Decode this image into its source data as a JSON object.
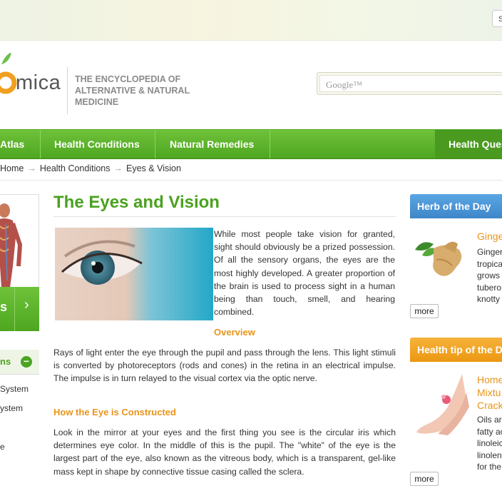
{
  "header": {
    "top_button": "S",
    "logo_text": "mica",
    "tagline": [
      "THE ENCYCLOPEDIA OF",
      "ALTERNATIVE & NATURAL",
      "MEDICINE"
    ],
    "search_placeholder": "Google™"
  },
  "nav": {
    "items": [
      "Atlas",
      "Health Conditions",
      "Natural Remedies",
      "Health Ques"
    ]
  },
  "breadcrumb": {
    "items": [
      "Home",
      "Health Conditions",
      "Eyes & Vision"
    ],
    "separator": "→"
  },
  "sidebar_left": {
    "banner_text": "s",
    "banner_chevron": "›",
    "systems_heading": "ns",
    "systems_toggle": "−",
    "items": [
      "System",
      "ystem",
      "e"
    ]
  },
  "article": {
    "title": "The Eyes and Vision",
    "intro": "While most people take vision for granted, sight should obviously be a prized possession.  Of all the sensory organs, the eyes are the most highly developed.  A greater proportion of the brain is used to process sight in a human being than touch, smell, and hearing combined.",
    "overview_heading": "Overview",
    "overview_text": "Rays of light enter the eye through the pupil and pass through the lens.  This light stimuli is converted by photoreceptors (rods and cones) in the retina in an electrical impulse.  The impulse is in turn relayed to the visual cortex via the optic nerve.",
    "construct_heading": "How the Eye is Constructed",
    "construct_text": "Look in the mirror at your eyes and the first thing you see is the circular iris which determines eye color.  In the middle of this is the pupil.  The \"white\" of the eye is the largest part of the eye, also known as the vitreous body, which is a transparent, gel-like mass kept in shape by connective tissue casing called the sclera."
  },
  "herb_panel": {
    "heading": "Herb of the Day",
    "title": "Ginge",
    "lines": [
      "Ginger",
      "tropica",
      "grows",
      "tubero",
      "knotty"
    ],
    "more": "more"
  },
  "tip_panel": {
    "heading": "Health tip of the D",
    "title_lines": [
      "Home",
      "Mixtu",
      "Crack"
    ],
    "lines": [
      "Oils ar",
      "fatty ac",
      "linoleic",
      "linolen",
      "for the"
    ],
    "more": "more"
  },
  "colors": {
    "brand_green": "#4ea620",
    "accent_orange": "#e8941a",
    "panel_blue": "#4a94d6",
    "panel_orange": "#f0a020"
  }
}
